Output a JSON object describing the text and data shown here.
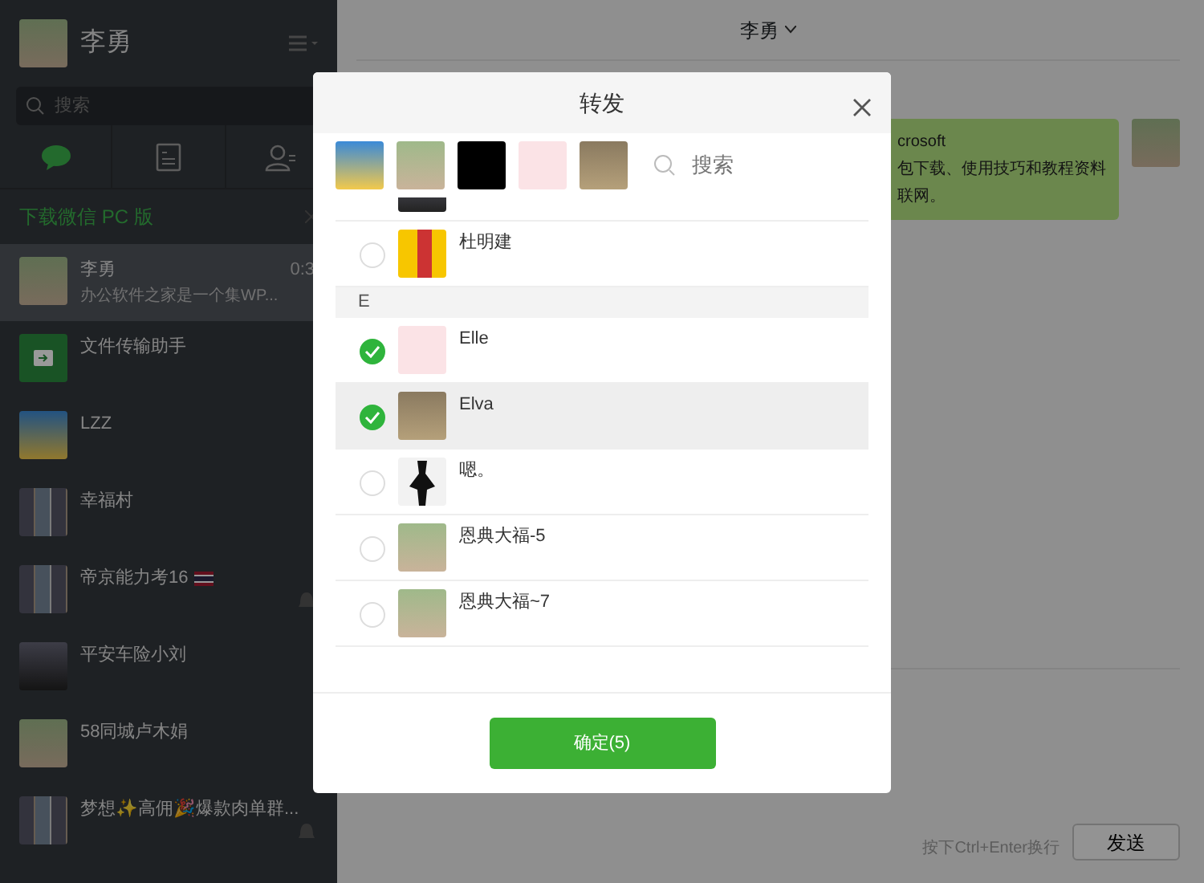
{
  "sidebar": {
    "user": {
      "name": "李勇"
    },
    "search": {
      "placeholder": "搜索"
    },
    "tabs": [
      {
        "kind": "chat",
        "selected": true
      },
      {
        "kind": "document",
        "selected": false
      },
      {
        "kind": "contacts",
        "selected": false
      }
    ],
    "banner": {
      "text": "下载微信 PC 版"
    },
    "chats": [
      {
        "name": "李勇",
        "time": "0:3",
        "preview": "办公软件之家是一个集WP...",
        "selected": true,
        "muted": false
      },
      {
        "name": "文件传输助手",
        "selected": false,
        "muted": false
      },
      {
        "name": "LZZ",
        "selected": false,
        "muted": false
      },
      {
        "name": "幸福村",
        "selected": false,
        "muted": false
      },
      {
        "name": "帝京能力考16",
        "selected": false,
        "muted": true,
        "flag": true
      },
      {
        "name": "平安车险小刘",
        "selected": false,
        "muted": false
      },
      {
        "name": "58同城卢木娟",
        "selected": false,
        "muted": false
      },
      {
        "name": "梦想✨高佣🎉爆款肉单群...",
        "selected": false,
        "muted": true
      }
    ]
  },
  "chat": {
    "title": "李勇",
    "messages": [
      {
        "lines": [
          "crosoft",
          "包下载、使用技巧和教程资料",
          "联网。"
        ]
      }
    ],
    "input": {
      "hint": "按下Ctrl+Enter换行",
      "send": "发送"
    }
  },
  "dialog": {
    "title": "转发",
    "search": {
      "placeholder": "搜索"
    },
    "rows": [
      {
        "kind": "partial"
      },
      {
        "kind": "contact",
        "name": "杜明建",
        "selected": false,
        "highlighted": false
      },
      {
        "kind": "section",
        "label": "E"
      },
      {
        "kind": "contact",
        "name": "Elle",
        "selected": true,
        "highlighted": false
      },
      {
        "kind": "contact",
        "name": "Elva",
        "selected": true,
        "highlighted": true
      },
      {
        "kind": "contact",
        "name": "嗯。",
        "selected": false,
        "highlighted": false
      },
      {
        "kind": "contact",
        "name": "恩典大福-5",
        "selected": false,
        "highlighted": false
      },
      {
        "kind": "contact",
        "name": "恩典大福~7",
        "selected": false,
        "highlighted": false
      }
    ],
    "confirm": "确定(5)"
  }
}
